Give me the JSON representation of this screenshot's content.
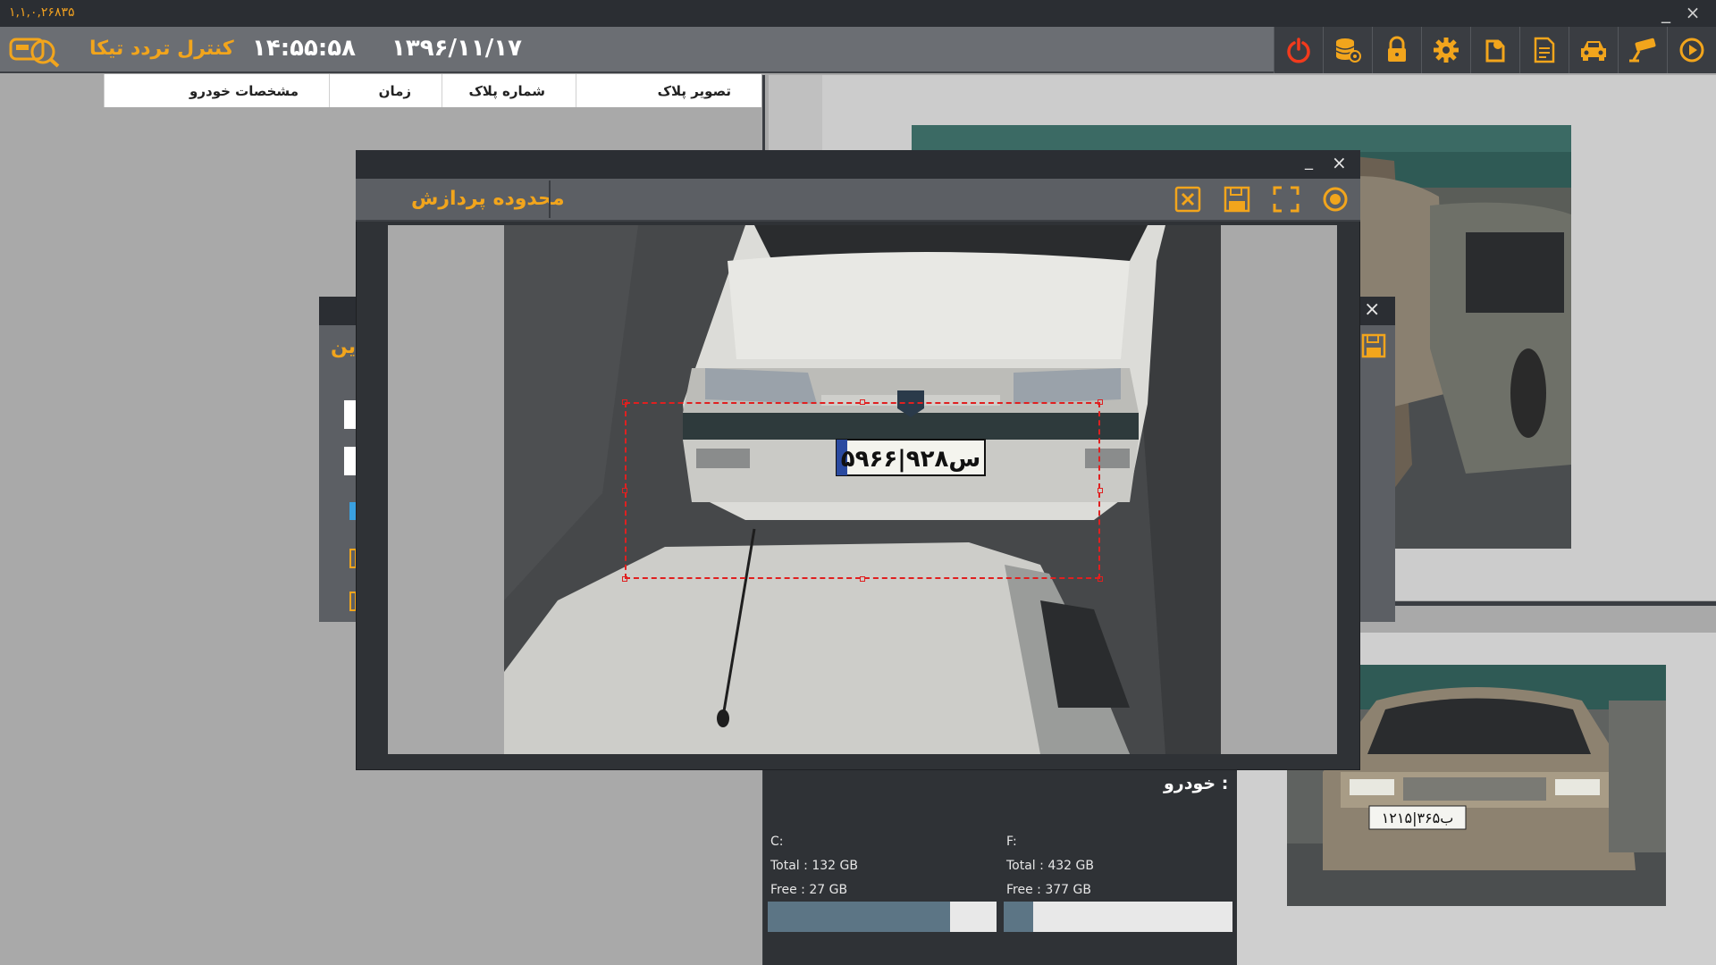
{
  "app": {
    "version": "۱,۱,۰,۲۶۸۳۵",
    "title": "کنترل تردد تیکا",
    "clock": "۱۴:۵۵:۵۸",
    "date": "۱۳۹۶/۱۱/۱۷",
    "window_buttons": {
      "minimize": "_",
      "close": "×"
    }
  },
  "toolbar": {
    "icons": [
      "power-icon",
      "database-icon",
      "lock-icon",
      "settings-gear-icon",
      "plate-tag-icon",
      "report-document-icon",
      "car-icon",
      "camera-icon",
      "play-icon"
    ],
    "accent": "#f2a51c"
  },
  "table": {
    "columns": [
      "تصویر پلاک",
      "شماره پلاک",
      "زمان",
      "مشخصات خودرو"
    ]
  },
  "back_dialog": {
    "title_fragment": "ین",
    "close": "×"
  },
  "dialog": {
    "title": "محدوده پردازش",
    "minimize": "_",
    "close": "×",
    "tools": [
      "cancel-icon",
      "save-icon",
      "fullscreen-icon",
      "record-icon"
    ]
  },
  "storage": {
    "vehicle_label": "خودرو :",
    "drives": [
      {
        "name": "C:",
        "total": "Total : 132 GB",
        "free": "Free : 27 GB",
        "used_fraction": 0.795
      },
      {
        "name": "F:",
        "total": "Total : 432 GB",
        "free": "Free : 377 GB",
        "used_fraction": 0.127
      }
    ]
  },
  "plates": {
    "main": "۵۹س۹۲۸|۶۶",
    "second": "۱۲ب۳۶۵|۱۵"
  }
}
